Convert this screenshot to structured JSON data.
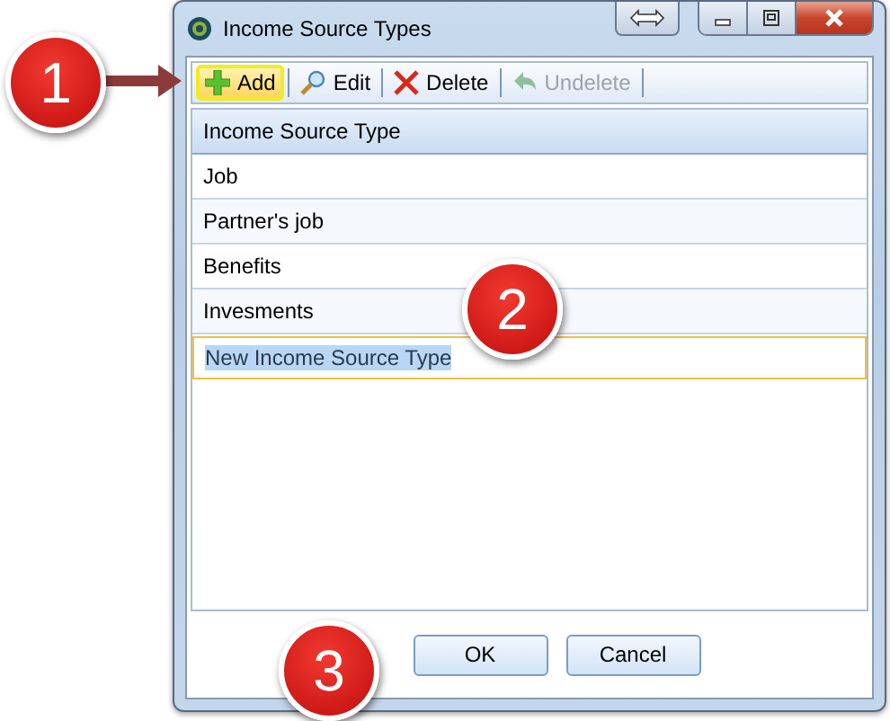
{
  "window": {
    "title": "Income Source Types"
  },
  "toolbar": [
    {
      "label": "Add",
      "kind": "add",
      "highlighted": true,
      "disabled": false
    },
    {
      "label": "Edit",
      "kind": "edit",
      "highlighted": false,
      "disabled": false
    },
    {
      "label": "Delete",
      "kind": "delete",
      "highlighted": false,
      "disabled": false
    },
    {
      "label": "Undelete",
      "kind": "undelete",
      "highlighted": false,
      "disabled": true
    }
  ],
  "grid": {
    "column": "Income Source Type",
    "rows": [
      {
        "value": "Job"
      },
      {
        "value": "Partner's job"
      },
      {
        "value": "Benefits"
      },
      {
        "value": "Invesments"
      }
    ],
    "new_row": {
      "value": "New Income Source Type"
    }
  },
  "buttons": [
    "OK",
    "Cancel"
  ],
  "callouts": [
    "1",
    "2",
    "3"
  ]
}
